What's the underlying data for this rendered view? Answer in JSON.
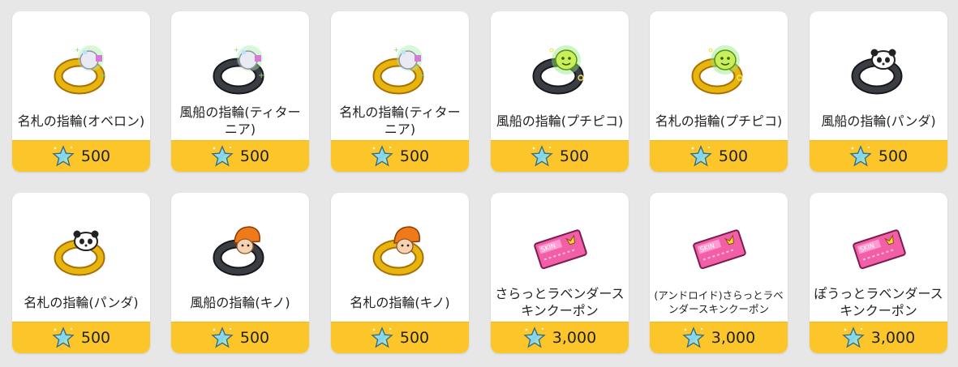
{
  "items": [
    {
      "name": "名札の指輪(オベロン)",
      "price": "500",
      "icon": "gold-ring-gem-icon",
      "ring": "gold",
      "small": false
    },
    {
      "name": "風船の指輪(ティターニア)",
      "price": "500",
      "icon": "black-ring-gem-icon",
      "ring": "black",
      "small": false
    },
    {
      "name": "名札の指輪(ティターニア)",
      "price": "500",
      "icon": "gold-ring-gem-icon",
      "ring": "gold",
      "small": false
    },
    {
      "name": "風船の指輪(プチピコ)",
      "price": "500",
      "icon": "black-ring-slime-icon",
      "ring": "black",
      "small": false
    },
    {
      "name": "名札の指輪(プチピコ)",
      "price": "500",
      "icon": "gold-ring-slime-icon",
      "ring": "gold",
      "small": false
    },
    {
      "name": "風船の指輪(パンダ)",
      "price": "500",
      "icon": "black-ring-panda-icon",
      "ring": "black",
      "small": false
    },
    {
      "name": "名札の指輪(パンダ)",
      "price": "500",
      "icon": "gold-ring-panda-icon",
      "ring": "gold",
      "small": false
    },
    {
      "name": "風船の指輪(キノ)",
      "price": "500",
      "icon": "black-ring-mushroom-icon",
      "ring": "black",
      "small": false
    },
    {
      "name": "名札の指輪(キノ)",
      "price": "500",
      "icon": "gold-ring-mushroom-icon",
      "ring": "gold",
      "small": false
    },
    {
      "name": "さらっとラベンダースキンクーポン",
      "price": "3,000",
      "icon": "pink-coupon-icon",
      "ring": "none",
      "small": false
    },
    {
      "name": "(アンドロイド)さらっとラベンダースキンクーポン",
      "price": "3,000",
      "icon": "pink-coupon-icon",
      "ring": "none",
      "small": true
    },
    {
      "name": "ぽうっとラベンダースキンクーポン",
      "price": "3,000",
      "icon": "pink-coupon-icon",
      "ring": "none",
      "small": false
    }
  ],
  "colors": {
    "price_bar": "#fcc529",
    "card": "#ffffff",
    "background": "#e7e7e7"
  },
  "price_icon": "star-icon"
}
